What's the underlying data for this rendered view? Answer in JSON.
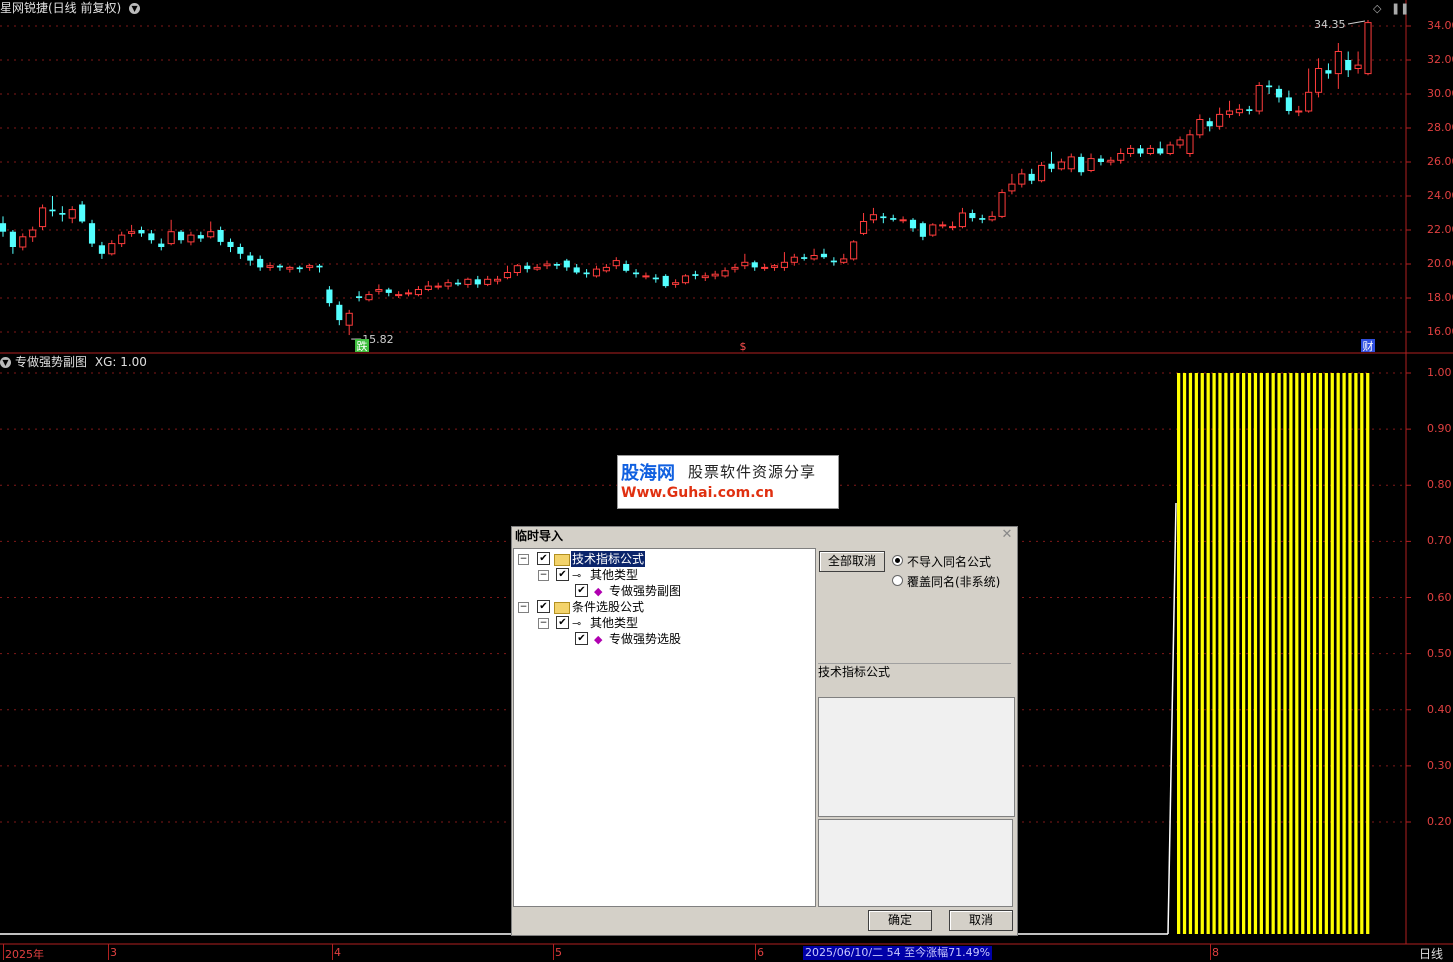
{
  "window": {
    "title": "星网锐捷(日线 前复权)",
    "period": "日线"
  },
  "main_chart": {
    "high_label": "34.35",
    "low_label": "15.82",
    "markers": [
      "跌",
      "$",
      "财"
    ],
    "y_ticks": [
      "34.00",
      "32.00",
      "30.00",
      "28.00",
      "26.00",
      "24.00",
      "22.00",
      "20.00",
      "18.00",
      "16.00"
    ]
  },
  "sub_chart": {
    "title": "专做强势副图",
    "xg_label": "XG: 1.00",
    "y_ticks": [
      "1.00",
      "0.90",
      "0.80",
      "0.70",
      "0.60",
      "0.50",
      "0.40",
      "0.30",
      "0.20"
    ]
  },
  "x_axis": {
    "labels": [
      "2025年",
      "3",
      "4",
      "5",
      "6",
      "8"
    ],
    "status": "2025/06/10/二 54 至今涨幅71.49%"
  },
  "watermark": {
    "line1a": "股海网",
    "line1b": "股票软件资源分享",
    "line2": "Www.Guhai.com.cn"
  },
  "dialog": {
    "title": "临时导入",
    "tree": [
      {
        "label": "技术指标公式",
        "level": 0,
        "type": "folder",
        "checked": true,
        "selected": true
      },
      {
        "label": "其他类型",
        "level": 1,
        "type": "key",
        "checked": true
      },
      {
        "label": "专做强势副图",
        "level": 2,
        "type": "item",
        "checked": true
      },
      {
        "label": "条件选股公式",
        "level": 0,
        "type": "folder",
        "checked": true
      },
      {
        "label": "其他类型",
        "level": 1,
        "type": "key",
        "checked": true
      },
      {
        "label": "专做强势选股",
        "level": 2,
        "type": "item",
        "checked": true
      }
    ],
    "cancel_all_label": "全部取消",
    "radio_options": [
      {
        "label": "不导入同名公式",
        "selected": true
      },
      {
        "label": "覆盖同名(非系统)",
        "selected": false
      }
    ],
    "section_label": "技术指标公式",
    "ok_label": "确定",
    "cancel_label": "取消"
  },
  "chart_data": {
    "type": "candlestick",
    "title": "星网锐捷(日线 前复权)",
    "x_labels": [
      "2025年",
      "3",
      "4",
      "5",
      "6",
      "8"
    ],
    "y_range": [
      15,
      35
    ],
    "high": 34.35,
    "low": 15.82,
    "candles": [
      [
        22.4,
        21.9,
        22.8,
        21.6
      ],
      [
        21.9,
        21.0,
        22.0,
        20.6
      ],
      [
        21.0,
        21.6,
        21.8,
        20.8
      ],
      [
        21.6,
        22.0,
        22.2,
        21.3
      ],
      [
        22.2,
        23.3,
        23.5,
        22.0
      ],
      [
        23.2,
        23.1,
        24.0,
        22.8
      ],
      [
        23.0,
        22.9,
        23.4,
        22.5
      ],
      [
        22.7,
        23.2,
        23.4,
        22.4
      ],
      [
        23.5,
        22.5,
        23.7,
        22.4
      ],
      [
        22.4,
        21.2,
        22.6,
        21.0
      ],
      [
        21.1,
        20.6,
        21.3,
        20.3
      ],
      [
        20.6,
        21.2,
        21.4,
        20.5
      ],
      [
        21.2,
        21.7,
        21.9,
        21.0
      ],
      [
        21.8,
        21.9,
        22.3,
        21.6
      ],
      [
        22.0,
        21.8,
        22.2,
        21.6
      ],
      [
        21.8,
        21.4,
        22.0,
        21.2
      ],
      [
        21.2,
        21.0,
        21.5,
        20.8
      ],
      [
        21.2,
        21.9,
        22.6,
        21.1
      ],
      [
        21.9,
        21.4,
        22.0,
        21.2
      ],
      [
        21.3,
        21.7,
        21.9,
        21.1
      ],
      [
        21.7,
        21.5,
        21.9,
        21.3
      ],
      [
        21.6,
        21.9,
        22.5,
        21.5
      ],
      [
        22.0,
        21.3,
        22.2,
        21.1
      ],
      [
        21.3,
        21.0,
        21.5,
        20.7
      ],
      [
        21.0,
        20.6,
        21.2,
        20.3
      ],
      [
        20.5,
        20.2,
        20.7,
        19.9
      ],
      [
        20.3,
        19.8,
        20.5,
        19.6
      ],
      [
        19.8,
        19.9,
        20.1,
        19.6
      ],
      [
        19.9,
        19.8,
        20.0,
        19.6
      ],
      [
        19.7,
        19.8,
        19.9,
        19.5
      ],
      [
        19.8,
        19.7,
        19.9,
        19.5
      ],
      [
        19.8,
        19.9,
        20.0,
        19.6
      ],
      [
        19.9,
        19.8,
        20.0,
        19.5
      ],
      [
        18.5,
        17.7,
        18.7,
        17.5
      ],
      [
        17.6,
        16.7,
        17.8,
        16.4
      ],
      [
        16.4,
        17.1,
        17.3,
        15.82
      ],
      [
        18.1,
        18.0,
        18.4,
        17.8
      ],
      [
        17.9,
        18.2,
        18.4,
        17.8
      ],
      [
        18.4,
        18.5,
        18.8,
        18.2
      ],
      [
        18.5,
        18.3,
        18.6,
        18.1
      ],
      [
        18.2,
        18.2,
        18.4,
        18.0
      ],
      [
        18.3,
        18.3,
        18.5,
        18.1
      ],
      [
        18.2,
        18.5,
        18.7,
        18.1
      ],
      [
        18.5,
        18.7,
        19.0,
        18.4
      ],
      [
        18.7,
        18.7,
        18.9,
        18.5
      ],
      [
        18.7,
        18.9,
        19.1,
        18.5
      ],
      [
        18.9,
        18.8,
        19.1,
        18.7
      ],
      [
        18.8,
        19.1,
        19.2,
        18.6
      ],
      [
        19.1,
        18.8,
        19.3,
        18.6
      ],
      [
        18.8,
        19.1,
        19.3,
        18.7
      ],
      [
        19.0,
        19.1,
        19.3,
        18.8
      ],
      [
        19.2,
        19.5,
        19.9,
        19.1
      ],
      [
        19.5,
        19.9,
        20.0,
        19.3
      ],
      [
        19.9,
        19.7,
        20.1,
        19.5
      ],
      [
        19.7,
        19.8,
        20.0,
        19.6
      ],
      [
        19.9,
        20.0,
        20.2,
        19.7
      ],
      [
        20.0,
        19.9,
        20.1,
        19.7
      ],
      [
        20.2,
        19.8,
        20.3,
        19.6
      ],
      [
        19.8,
        19.5,
        20.0,
        19.4
      ],
      [
        19.5,
        19.4,
        19.7,
        19.2
      ],
      [
        19.3,
        19.7,
        19.9,
        19.2
      ],
      [
        19.6,
        19.8,
        20.0,
        19.5
      ],
      [
        19.9,
        20.2,
        20.4,
        19.7
      ],
      [
        20.0,
        19.6,
        20.2,
        19.5
      ],
      [
        19.5,
        19.4,
        19.7,
        19.2
      ],
      [
        19.3,
        19.3,
        19.5,
        19.1
      ],
      [
        19.2,
        19.1,
        19.4,
        18.9
      ],
      [
        19.3,
        18.7,
        19.4,
        18.6
      ],
      [
        18.8,
        18.9,
        19.1,
        18.6
      ],
      [
        18.9,
        19.3,
        19.4,
        18.8
      ],
      [
        19.4,
        19.3,
        19.6,
        19.1
      ],
      [
        19.2,
        19.3,
        19.5,
        19.0
      ],
      [
        19.3,
        19.4,
        19.6,
        19.1
      ],
      [
        19.3,
        19.6,
        19.8,
        19.2
      ],
      [
        19.7,
        19.8,
        20.0,
        19.5
      ],
      [
        19.9,
        20.1,
        20.6,
        19.7
      ],
      [
        20.1,
        19.8,
        20.2,
        19.6
      ],
      [
        19.8,
        19.8,
        20.0,
        19.6
      ],
      [
        19.8,
        19.9,
        20.0,
        19.6
      ],
      [
        19.8,
        20.1,
        20.7,
        19.6
      ],
      [
        20.1,
        20.4,
        20.6,
        19.9
      ],
      [
        20.4,
        20.3,
        20.6,
        20.2
      ],
      [
        20.3,
        20.5,
        20.9,
        20.2
      ],
      [
        20.6,
        20.4,
        20.9,
        20.3
      ],
      [
        20.2,
        20.1,
        20.4,
        19.9
      ],
      [
        20.1,
        20.3,
        20.6,
        20.0
      ],
      [
        20.3,
        21.3,
        21.4,
        20.2
      ],
      [
        21.8,
        22.5,
        23.0,
        21.7
      ],
      [
        22.6,
        22.9,
        23.3,
        22.4
      ],
      [
        22.8,
        22.7,
        23.0,
        22.4
      ],
      [
        22.7,
        22.6,
        22.9,
        22.5
      ],
      [
        22.6,
        22.6,
        22.8,
        22.4
      ],
      [
        22.6,
        22.1,
        22.7,
        21.9
      ],
      [
        22.4,
        21.6,
        22.5,
        21.4
      ],
      [
        21.7,
        22.3,
        22.4,
        21.6
      ],
      [
        22.3,
        22.3,
        22.5,
        22.1
      ],
      [
        22.2,
        22.2,
        22.5,
        22.0
      ],
      [
        22.2,
        23.0,
        23.3,
        22.1
      ],
      [
        23.0,
        22.7,
        23.2,
        22.5
      ],
      [
        22.7,
        22.6,
        22.9,
        22.4
      ],
      [
        22.6,
        22.8,
        23.1,
        22.5
      ],
      [
        22.8,
        24.2,
        24.4,
        22.7
      ],
      [
        24.3,
        24.7,
        25.3,
        24.1
      ],
      [
        24.7,
        25.3,
        25.6,
        24.5
      ],
      [
        25.3,
        24.9,
        25.6,
        24.7
      ],
      [
        24.9,
        25.8,
        26.0,
        24.8
      ],
      [
        25.9,
        25.6,
        26.6,
        25.4
      ],
      [
        25.6,
        26.0,
        26.2,
        25.5
      ],
      [
        25.6,
        26.3,
        26.5,
        25.4
      ],
      [
        26.3,
        25.4,
        26.5,
        25.2
      ],
      [
        25.5,
        26.2,
        26.5,
        25.4
      ],
      [
        26.2,
        26.0,
        26.4,
        25.8
      ],
      [
        26.0,
        26.1,
        26.3,
        25.8
      ],
      [
        26.1,
        26.5,
        26.8,
        25.9
      ],
      [
        26.5,
        26.8,
        27.0,
        26.3
      ],
      [
        26.8,
        26.5,
        27.0,
        26.3
      ],
      [
        26.5,
        26.8,
        27.0,
        26.4
      ],
      [
        26.8,
        26.5,
        27.2,
        26.4
      ],
      [
        26.5,
        27.0,
        27.2,
        26.4
      ],
      [
        27.0,
        27.3,
        27.5,
        26.8
      ],
      [
        26.5,
        27.6,
        27.9,
        26.3
      ],
      [
        27.6,
        28.5,
        28.8,
        27.4
      ],
      [
        28.4,
        28.1,
        28.6,
        27.8
      ],
      [
        28.1,
        28.8,
        29.2,
        27.9
      ],
      [
        28.8,
        29.0,
        29.6,
        28.6
      ],
      [
        28.9,
        29.1,
        29.4,
        28.7
      ],
      [
        29.1,
        29.0,
        29.3,
        28.8
      ],
      [
        29.0,
        30.5,
        30.7,
        28.8
      ],
      [
        30.5,
        30.4,
        30.8,
        30.0
      ],
      [
        30.3,
        29.8,
        30.5,
        29.5
      ],
      [
        29.8,
        29.0,
        30.2,
        28.8
      ],
      [
        29.0,
        29.0,
        29.3,
        28.7
      ],
      [
        29.0,
        30.1,
        31.5,
        28.9
      ],
      [
        30.1,
        31.5,
        32.1,
        29.8
      ],
      [
        31.4,
        31.2,
        31.8,
        30.9
      ],
      [
        31.2,
        32.5,
        33.0,
        30.3
      ],
      [
        32.0,
        31.4,
        32.5,
        31.0
      ],
      [
        31.5,
        31.7,
        32.5,
        31.2
      ],
      [
        31.2,
        34.2,
        34.35,
        31.1
      ]
    ],
    "sub_series": {
      "name": "XG",
      "value": 1.0
    }
  }
}
